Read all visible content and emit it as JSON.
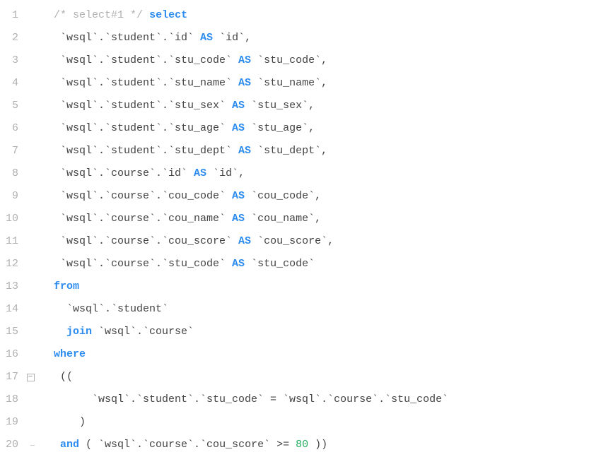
{
  "chart_data": null,
  "code": {
    "lines": [
      {
        "n": 1,
        "fold": "",
        "tokens": [
          [
            "text",
            "  "
          ],
          [
            "comment",
            "/* select#1 */"
          ],
          [
            "text",
            " "
          ],
          [
            "keyword",
            "select"
          ]
        ]
      },
      {
        "n": 2,
        "fold": "",
        "tokens": [
          [
            "text",
            "   `wsql`.`student`.`id` "
          ],
          [
            "keyword",
            "AS"
          ],
          [
            "text",
            " `id`,"
          ]
        ]
      },
      {
        "n": 3,
        "fold": "",
        "tokens": [
          [
            "text",
            "   `wsql`.`student`.`stu_code` "
          ],
          [
            "keyword",
            "AS"
          ],
          [
            "text",
            " `stu_code`,"
          ]
        ]
      },
      {
        "n": 4,
        "fold": "",
        "tokens": [
          [
            "text",
            "   `wsql`.`student`.`stu_name` "
          ],
          [
            "keyword",
            "AS"
          ],
          [
            "text",
            " `stu_name`,"
          ]
        ]
      },
      {
        "n": 5,
        "fold": "",
        "tokens": [
          [
            "text",
            "   `wsql`.`student`.`stu_sex` "
          ],
          [
            "keyword",
            "AS"
          ],
          [
            "text",
            " `stu_sex`,"
          ]
        ]
      },
      {
        "n": 6,
        "fold": "",
        "tokens": [
          [
            "text",
            "   `wsql`.`student`.`stu_age` "
          ],
          [
            "keyword",
            "AS"
          ],
          [
            "text",
            " `stu_age`,"
          ]
        ]
      },
      {
        "n": 7,
        "fold": "",
        "tokens": [
          [
            "text",
            "   `wsql`.`student`.`stu_dept` "
          ],
          [
            "keyword",
            "AS"
          ],
          [
            "text",
            " `stu_dept`,"
          ]
        ]
      },
      {
        "n": 8,
        "fold": "",
        "tokens": [
          [
            "text",
            "   `wsql`.`course`.`id` "
          ],
          [
            "keyword",
            "AS"
          ],
          [
            "text",
            " `id`,"
          ]
        ]
      },
      {
        "n": 9,
        "fold": "",
        "tokens": [
          [
            "text",
            "   `wsql`.`course`.`cou_code` "
          ],
          [
            "keyword",
            "AS"
          ],
          [
            "text",
            " `cou_code`,"
          ]
        ]
      },
      {
        "n": 10,
        "fold": "",
        "tokens": [
          [
            "text",
            "   `wsql`.`course`.`cou_name` "
          ],
          [
            "keyword",
            "AS"
          ],
          [
            "text",
            " `cou_name`,"
          ]
        ]
      },
      {
        "n": 11,
        "fold": "",
        "tokens": [
          [
            "text",
            "   `wsql`.`course`.`cou_score` "
          ],
          [
            "keyword",
            "AS"
          ],
          [
            "text",
            " `cou_score`,"
          ]
        ]
      },
      {
        "n": 12,
        "fold": "",
        "tokens": [
          [
            "text",
            "   `wsql`.`course`.`stu_code` "
          ],
          [
            "keyword",
            "AS"
          ],
          [
            "text",
            " `stu_code`"
          ]
        ]
      },
      {
        "n": 13,
        "fold": "",
        "tokens": [
          [
            "text",
            "  "
          ],
          [
            "keyword",
            "from"
          ]
        ]
      },
      {
        "n": 14,
        "fold": "",
        "tokens": [
          [
            "text",
            "    `wsql`.`student`"
          ]
        ]
      },
      {
        "n": 15,
        "fold": "",
        "tokens": [
          [
            "text",
            "    "
          ],
          [
            "keyword",
            "join"
          ],
          [
            "text",
            " `wsql`.`course`"
          ]
        ]
      },
      {
        "n": 16,
        "fold": "",
        "tokens": [
          [
            "text",
            "  "
          ],
          [
            "keyword",
            "where"
          ]
        ]
      },
      {
        "n": 17,
        "fold": "box",
        "tokens": [
          [
            "text",
            "   (("
          ]
        ]
      },
      {
        "n": 18,
        "fold": "line",
        "tokens": [
          [
            "text",
            "        `wsql`.`student`.`stu_code` = `wsql`.`course`.`stu_code`"
          ]
        ]
      },
      {
        "n": 19,
        "fold": "line",
        "tokens": [
          [
            "text",
            "      )"
          ]
        ]
      },
      {
        "n": 20,
        "fold": "end",
        "tokens": [
          [
            "text",
            "   "
          ],
          [
            "keyword",
            "and"
          ],
          [
            "text",
            " ( `wsql`.`course`.`cou_score` >= "
          ],
          [
            "number",
            "80"
          ],
          [
            "text",
            " ))"
          ]
        ]
      }
    ]
  }
}
